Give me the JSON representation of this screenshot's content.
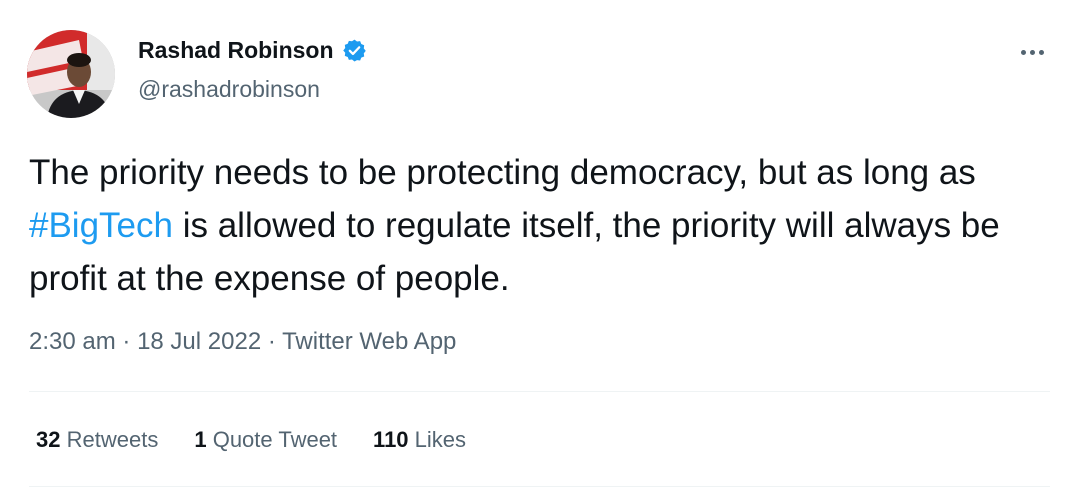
{
  "author": {
    "display_name": "Rashad Robinson",
    "handle": "@rashadrobinson",
    "avatar_icon": "profile-photo",
    "verified_icon": "verified-badge-icon",
    "verified_color": "#1d9bf0"
  },
  "tweet": {
    "text_before": "The priority needs to be protecting democracy, but as long as ",
    "hashtag": "#BigTech",
    "text_after": " is allowed to regulate itself, the priority will always be profit at the expense of people."
  },
  "meta": {
    "time": "2:30 am",
    "sep1": "·",
    "date": "18 Jul 2022",
    "sep2": "·",
    "source": "Twitter Web App"
  },
  "stats": {
    "retweets_count": "32",
    "retweets_label": "Retweets",
    "quotes_count": "1",
    "quotes_label": "Quote Tweet",
    "likes_count": "110",
    "likes_label": "Likes"
  },
  "colors": {
    "link": "#1d9bf0",
    "secondary_text": "#536471",
    "primary_text": "#0f1419"
  }
}
